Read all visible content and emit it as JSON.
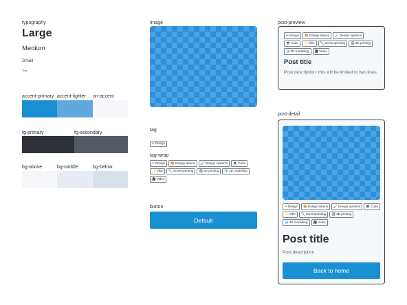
{
  "typography": {
    "label": "typography",
    "large": "Large",
    "medium": "Medium",
    "small": "Small",
    "tiny": "Tiny"
  },
  "accent": {
    "primary_label": "accent-primary",
    "lighter_label": "accent-lighter",
    "on_label": "on-accent",
    "colors": {
      "primary": "#1a8fd1",
      "lighter": "#5fa9dd",
      "on": "#f5f7fa"
    }
  },
  "fg": {
    "primary_label": "fg-primary",
    "secondary_label": "fg-secondary",
    "colors": {
      "primary": "#2f3238",
      "secondary": "#525a65"
    }
  },
  "bg": {
    "above_label": "bg-above",
    "middle_label": "bg-middle",
    "below_label": "bg-below",
    "colors": {
      "above": "#f5f7fa",
      "middle": "#e7ebf2",
      "below": "#d8e0ea"
    }
  },
  "image": {
    "label": "image"
  },
  "tag": {
    "label": "tag",
    "single": {
      "icon": "✏",
      "text": "Design"
    }
  },
  "tag_wrap": {
    "label": "tag-wrap",
    "items": [
      {
        "icon": "✏",
        "text": "Design"
      },
      {
        "icon": "🎨",
        "text": "Design tokens"
      },
      {
        "icon": "🖌",
        "text": "Design systems"
      },
      {
        "icon": "💻",
        "text": "Code"
      },
      {
        "icon": "✨",
        "text": "Vibe"
      },
      {
        "icon": "🔍",
        "text": "Screenprinting"
      },
      {
        "icon": "🖨",
        "text": "3D printing"
      },
      {
        "icon": "🧊",
        "text": "3D modelling"
      },
      {
        "icon": "🎥",
        "text": "Video"
      }
    ]
  },
  "button": {
    "label": "button",
    "text": "Default"
  },
  "post_preview": {
    "label": "post-preview",
    "title": "Post title",
    "description": "Post description: this will be limited to two lines"
  },
  "post_detail": {
    "label": "post-detail",
    "title": "Post title",
    "description": "Post description",
    "button": "Back to home"
  }
}
